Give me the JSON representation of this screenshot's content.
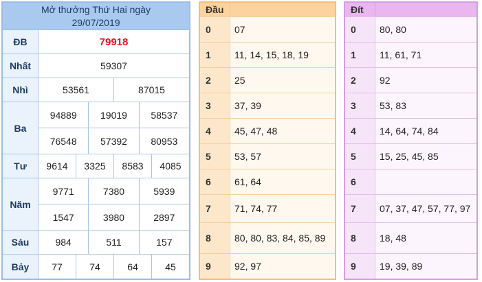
{
  "results": {
    "title": "Mở thưởng Thứ Hai ngày",
    "date": "29/07/2019",
    "rows": [
      {
        "label": "ĐB",
        "lines": [
          [
            "79918"
          ]
        ]
      },
      {
        "label": "Nhất",
        "lines": [
          [
            "59307"
          ]
        ]
      },
      {
        "label": "Nhì",
        "lines": [
          [
            "53561",
            "87015"
          ]
        ]
      },
      {
        "label": "Ba",
        "lines": [
          [
            "94889",
            "19019",
            "58537"
          ],
          [
            "76548",
            "57392",
            "80953"
          ]
        ]
      },
      {
        "label": "Tư",
        "lines": [
          [
            "9614",
            "3325",
            "8583",
            "4085"
          ]
        ]
      },
      {
        "label": "Năm",
        "lines": [
          [
            "9771",
            "7380",
            "5939"
          ],
          [
            "1547",
            "3980",
            "2897"
          ]
        ]
      },
      {
        "label": "Sáu",
        "lines": [
          [
            "984",
            "511",
            "157"
          ]
        ]
      },
      {
        "label": "Bảy",
        "lines": [
          [
            "77",
            "74",
            "64",
            "45"
          ]
        ]
      }
    ],
    "special_color": "#e2151b"
  },
  "dau": {
    "header": "Đầu",
    "rows": [
      {
        "key": "0",
        "values": "07"
      },
      {
        "key": "1",
        "values": "11, 14, 15, 18, 19"
      },
      {
        "key": "2",
        "values": "25"
      },
      {
        "key": "3",
        "values": "37, 39"
      },
      {
        "key": "4",
        "values": "45, 47, 48"
      },
      {
        "key": "5",
        "values": "53, 57"
      },
      {
        "key": "6",
        "values": "61, 64"
      },
      {
        "key": "7",
        "values": "71, 74, 77"
      },
      {
        "key": "8",
        "values": "80, 80, 83, 84, 85, 89"
      },
      {
        "key": "9",
        "values": "92, 97"
      }
    ],
    "header_color": "#fcd39e"
  },
  "dit": {
    "header": "Đít",
    "rows": [
      {
        "key": "0",
        "values": "80, 80"
      },
      {
        "key": "1",
        "values": "11, 61, 71"
      },
      {
        "key": "2",
        "values": "92"
      },
      {
        "key": "3",
        "values": "53, 83"
      },
      {
        "key": "4",
        "values": "14, 64, 74, 84"
      },
      {
        "key": "5",
        "values": "15, 25, 45, 85"
      },
      {
        "key": "6",
        "values": ""
      },
      {
        "key": "7",
        "values": "07, 37, 47, 57, 77, 97"
      },
      {
        "key": "8",
        "values": "18, 48"
      },
      {
        "key": "9",
        "values": "19, 39, 89"
      }
    ],
    "header_color": "#e9b6f0"
  }
}
